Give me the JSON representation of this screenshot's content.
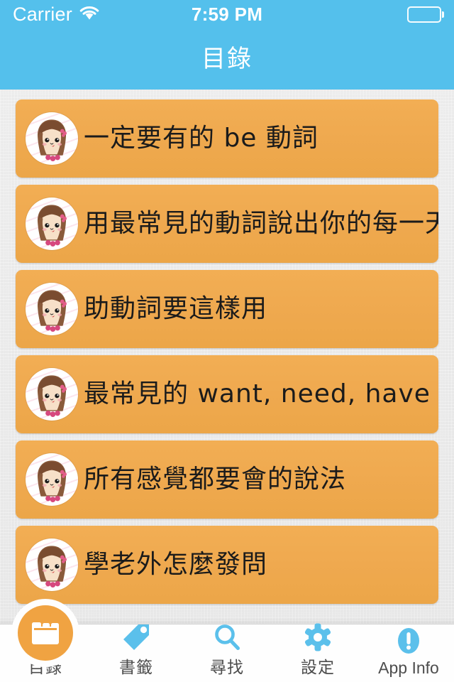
{
  "status_bar": {
    "carrier": "Carrier",
    "wifi_icon": "wifi-icon",
    "time": "7:59 PM",
    "battery_icon": "battery-icon"
  },
  "nav_bar": {
    "title": "目錄",
    "background_color": "#54c0ec"
  },
  "list": {
    "cell_color": "#efa94f",
    "avatar_icon": "girl-avatar-icon",
    "items": [
      {
        "title": "一定要有的 be 動詞"
      },
      {
        "title": "用最常見的動詞說出你的每一天"
      },
      {
        "title": "助動詞要這樣用"
      },
      {
        "title": "最常見的 want, need, have"
      },
      {
        "title": "所有感覺都要會的說法"
      },
      {
        "title": "學老外怎麼發問"
      }
    ]
  },
  "tab_bar": {
    "accent_color": "#5bc0eb",
    "selected_color": "#f0a342",
    "tabs": [
      {
        "label": "目錄",
        "icon": "catalog-icon",
        "selected": true
      },
      {
        "label": "書籤",
        "icon": "tag-icon",
        "selected": false
      },
      {
        "label": "尋找",
        "icon": "search-icon",
        "selected": false
      },
      {
        "label": "設定",
        "icon": "gear-icon",
        "selected": false
      },
      {
        "label": "App Info",
        "icon": "info-icon",
        "selected": false
      }
    ]
  }
}
